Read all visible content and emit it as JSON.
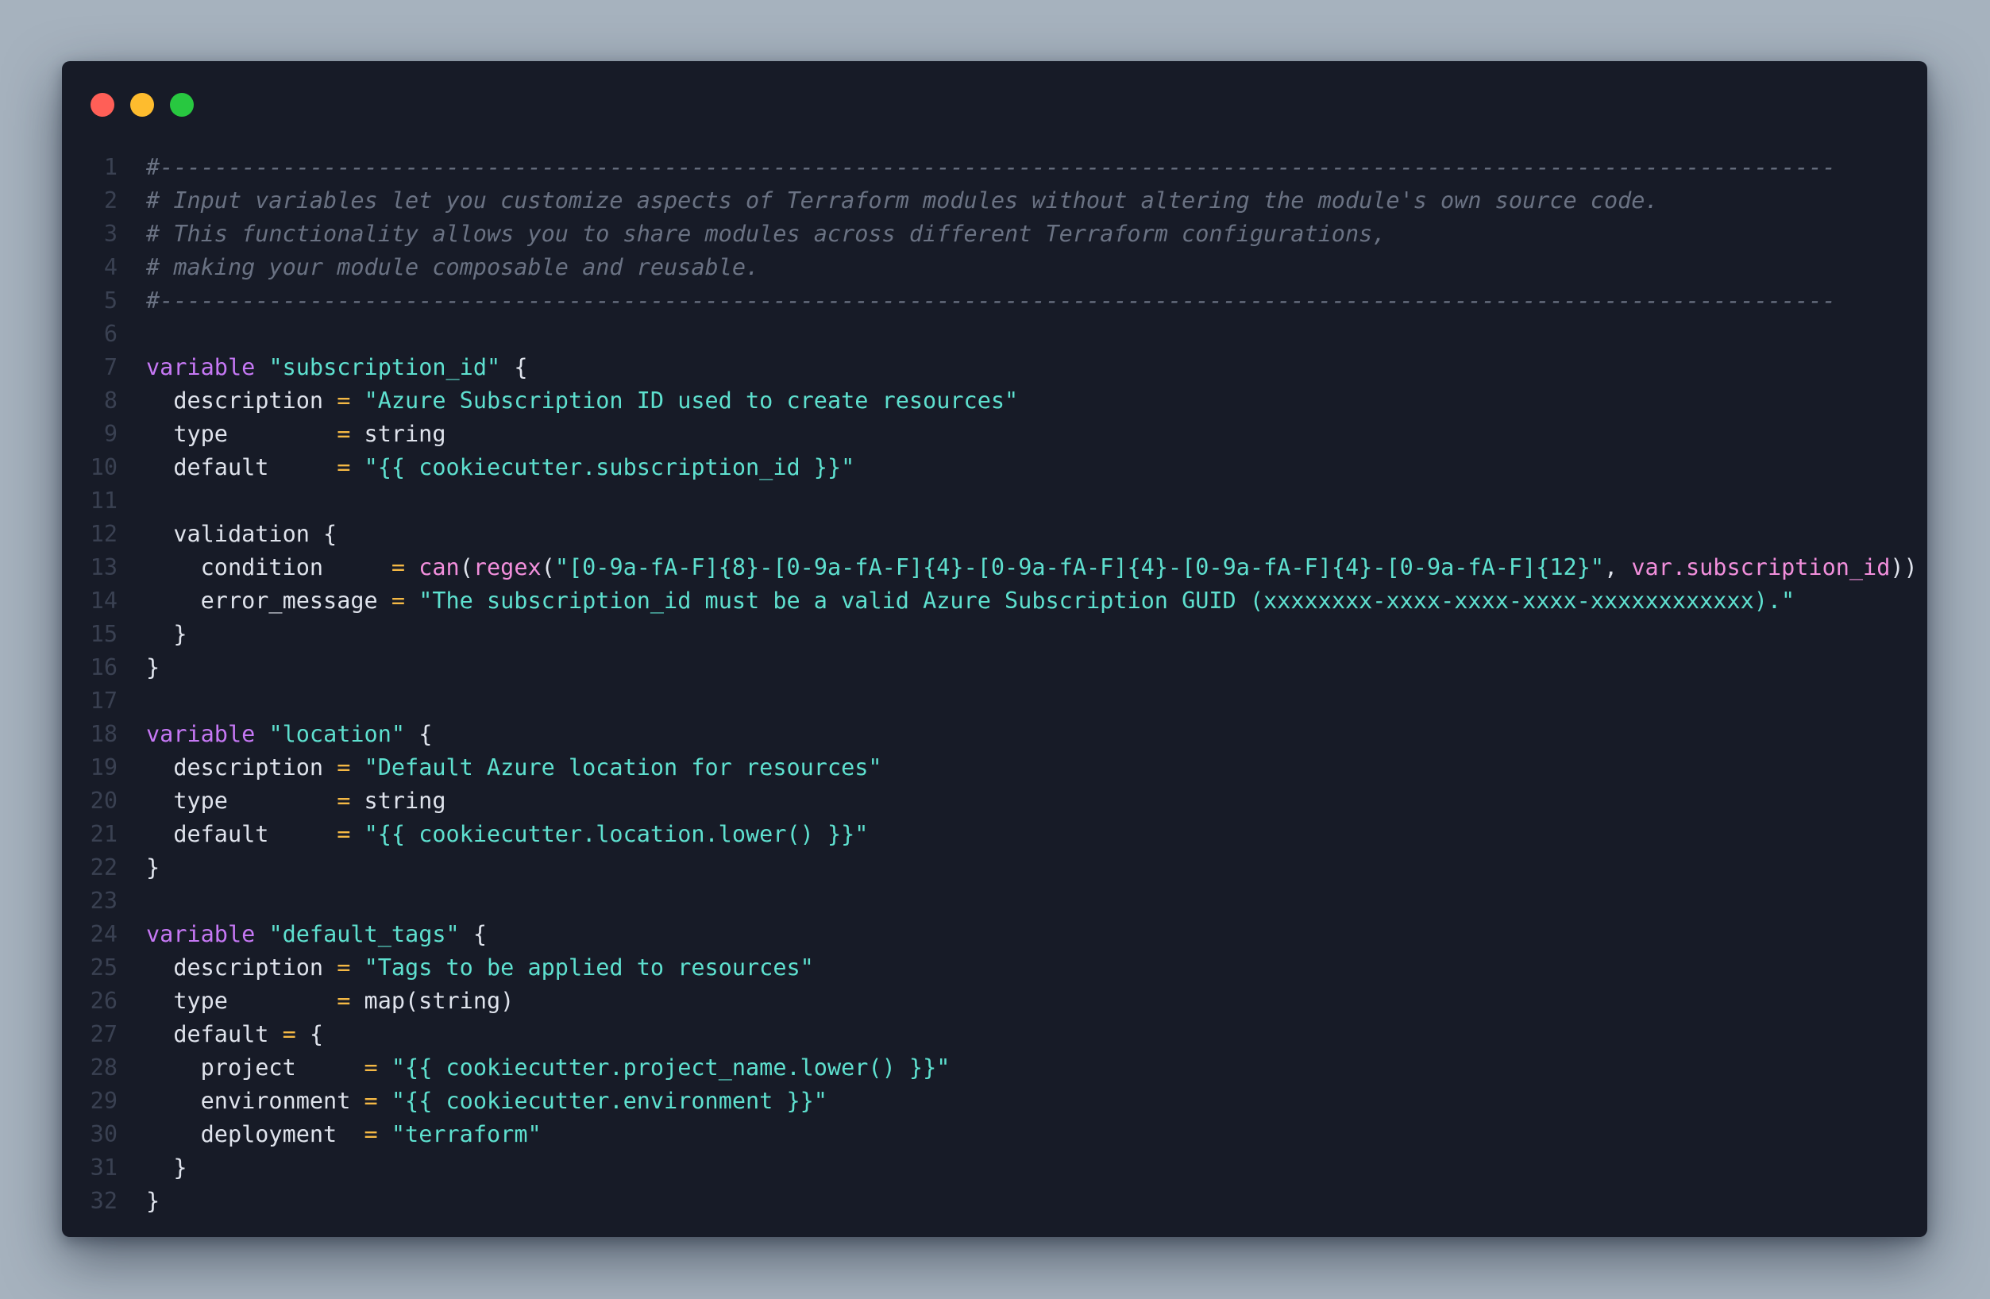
{
  "window": {
    "controls": {
      "close_color": "#ff5f57",
      "minimize_color": "#febc2e",
      "maximize_color": "#28c840"
    }
  },
  "theme": {
    "background": "#171b27",
    "comment": "#6a7283",
    "keyword": "#c678f5",
    "string": "#5ee0cf",
    "function": "#f28fdc",
    "operator": "#f5b945",
    "text": "#dfe3ec",
    "line_number": "#3a4152"
  },
  "code": {
    "lines": [
      [
        {
          "t": "c",
          "v": "#---------------------------------------------------------------------------------------------------------------------------"
        }
      ],
      [
        {
          "t": "c",
          "v": "# Input variables let you customize aspects of Terraform modules without altering the module's own source code."
        }
      ],
      [
        {
          "t": "c",
          "v": "# This functionality allows you to share modules across different Terraform configurations,"
        }
      ],
      [
        {
          "t": "c",
          "v": "# making your module composable and reusable."
        }
      ],
      [
        {
          "t": "c",
          "v": "#---------------------------------------------------------------------------------------------------------------------------"
        }
      ],
      [],
      [
        {
          "t": "kw",
          "v": "variable"
        },
        {
          "t": "id",
          "v": " "
        },
        {
          "t": "st",
          "v": "\"subscription_id\""
        },
        {
          "t": "id",
          "v": " {"
        }
      ],
      [
        {
          "t": "id",
          "v": "  description "
        },
        {
          "t": "op",
          "v": "="
        },
        {
          "t": "id",
          "v": " "
        },
        {
          "t": "st",
          "v": "\"Azure Subscription ID used to create resources\""
        }
      ],
      [
        {
          "t": "id",
          "v": "  type        "
        },
        {
          "t": "op",
          "v": "="
        },
        {
          "t": "id",
          "v": " string"
        }
      ],
      [
        {
          "t": "id",
          "v": "  default     "
        },
        {
          "t": "op",
          "v": "="
        },
        {
          "t": "id",
          "v": " "
        },
        {
          "t": "st",
          "v": "\"{{ cookiecutter.subscription_id }}\""
        }
      ],
      [],
      [
        {
          "t": "id",
          "v": "  validation {"
        }
      ],
      [
        {
          "t": "id",
          "v": "    condition     "
        },
        {
          "t": "op",
          "v": "="
        },
        {
          "t": "id",
          "v": " "
        },
        {
          "t": "fn",
          "v": "can"
        },
        {
          "t": "id",
          "v": "("
        },
        {
          "t": "fn",
          "v": "regex"
        },
        {
          "t": "id",
          "v": "("
        },
        {
          "t": "st",
          "v": "\"[0-9a-fA-F]{8}-[0-9a-fA-F]{4}-[0-9a-fA-F]{4}-[0-9a-fA-F]{4}-[0-9a-fA-F]{12}\""
        },
        {
          "t": "id",
          "v": ", "
        },
        {
          "t": "fn",
          "v": "var.subscription_id"
        },
        {
          "t": "id",
          "v": "))"
        }
      ],
      [
        {
          "t": "id",
          "v": "    error_message "
        },
        {
          "t": "op",
          "v": "="
        },
        {
          "t": "id",
          "v": " "
        },
        {
          "t": "st",
          "v": "\"The subscription_id must be a valid Azure Subscription GUID (xxxxxxxx-xxxx-xxxx-xxxx-xxxxxxxxxxxx).\""
        }
      ],
      [
        {
          "t": "id",
          "v": "  }"
        }
      ],
      [
        {
          "t": "id",
          "v": "}"
        }
      ],
      [],
      [
        {
          "t": "kw",
          "v": "variable"
        },
        {
          "t": "id",
          "v": " "
        },
        {
          "t": "st",
          "v": "\"location\""
        },
        {
          "t": "id",
          "v": " {"
        }
      ],
      [
        {
          "t": "id",
          "v": "  description "
        },
        {
          "t": "op",
          "v": "="
        },
        {
          "t": "id",
          "v": " "
        },
        {
          "t": "st",
          "v": "\"Default Azure location for resources\""
        }
      ],
      [
        {
          "t": "id",
          "v": "  type        "
        },
        {
          "t": "op",
          "v": "="
        },
        {
          "t": "id",
          "v": " string"
        }
      ],
      [
        {
          "t": "id",
          "v": "  default     "
        },
        {
          "t": "op",
          "v": "="
        },
        {
          "t": "id",
          "v": " "
        },
        {
          "t": "st",
          "v": "\"{{ cookiecutter.location.lower() }}\""
        }
      ],
      [
        {
          "t": "id",
          "v": "}"
        }
      ],
      [],
      [
        {
          "t": "kw",
          "v": "variable"
        },
        {
          "t": "id",
          "v": " "
        },
        {
          "t": "st",
          "v": "\"default_tags\""
        },
        {
          "t": "id",
          "v": " {"
        }
      ],
      [
        {
          "t": "id",
          "v": "  description "
        },
        {
          "t": "op",
          "v": "="
        },
        {
          "t": "id",
          "v": " "
        },
        {
          "t": "st",
          "v": "\"Tags to be applied to resources\""
        }
      ],
      [
        {
          "t": "id",
          "v": "  type        "
        },
        {
          "t": "op",
          "v": "="
        },
        {
          "t": "id",
          "v": " map(string)"
        }
      ],
      [
        {
          "t": "id",
          "v": "  default "
        },
        {
          "t": "op",
          "v": "="
        },
        {
          "t": "id",
          "v": " {"
        }
      ],
      [
        {
          "t": "id",
          "v": "    project     "
        },
        {
          "t": "op",
          "v": "="
        },
        {
          "t": "id",
          "v": " "
        },
        {
          "t": "st",
          "v": "\"{{ cookiecutter.project_name.lower() }}\""
        }
      ],
      [
        {
          "t": "id",
          "v": "    environment "
        },
        {
          "t": "op",
          "v": "="
        },
        {
          "t": "id",
          "v": " "
        },
        {
          "t": "st",
          "v": "\"{{ cookiecutter.environment }}\""
        }
      ],
      [
        {
          "t": "id",
          "v": "    deployment  "
        },
        {
          "t": "op",
          "v": "="
        },
        {
          "t": "id",
          "v": " "
        },
        {
          "t": "st",
          "v": "\"terraform\""
        }
      ],
      [
        {
          "t": "id",
          "v": "  }"
        }
      ],
      [
        {
          "t": "id",
          "v": "}"
        }
      ]
    ]
  }
}
